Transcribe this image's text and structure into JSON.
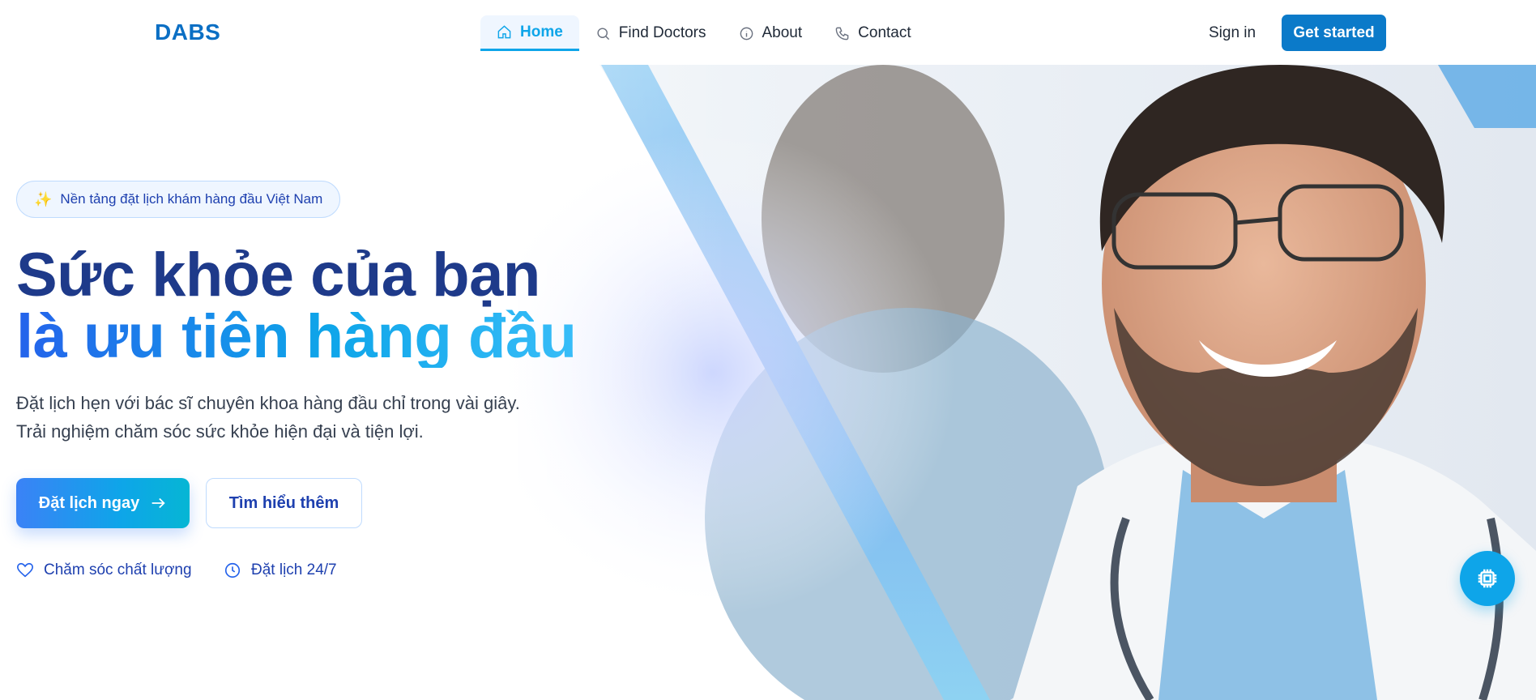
{
  "brand": {
    "name": "DABS",
    "color": "#0b6fc4"
  },
  "nav": {
    "items": [
      {
        "label": "Home",
        "icon": "home-icon",
        "active": true
      },
      {
        "label": "Find Doctors",
        "icon": "search-icon",
        "active": false
      },
      {
        "label": "About",
        "icon": "info-icon",
        "active": false
      },
      {
        "label": "Contact",
        "icon": "phone-icon",
        "active": false
      }
    ],
    "signin_label": "Sign in",
    "get_started_label": "Get started"
  },
  "hero": {
    "badge": "Nền tảng đặt lịch khám hàng đầu Việt Nam",
    "badge_icon": "sparkles-icon",
    "title_line1": "Sức khỏe của bạn",
    "title_line2": "là ưu tiên hàng đầu",
    "desc_line1": "Đặt lịch hẹn với bác sĩ chuyên khoa hàng đầu chỉ trong vài giây.",
    "desc_line2": "Trải nghiệm chăm sóc sức khỏe hiện đại và tiện lợi.",
    "primary_cta": "Đặt lịch ngay",
    "primary_cta_icon": "arrow-right-icon",
    "secondary_cta": "Tìm hiểu thêm",
    "features": [
      {
        "label": "Chăm sóc chất lượng",
        "icon": "heart-icon"
      },
      {
        "label": "Đặt lịch 24/7",
        "icon": "clock-icon"
      }
    ]
  },
  "chat_fab_icon": "chip-icon",
  "colors": {
    "accent": "#0ea5e9",
    "primary_dark": "#1e3a8a",
    "button": "#0b7ac9"
  }
}
